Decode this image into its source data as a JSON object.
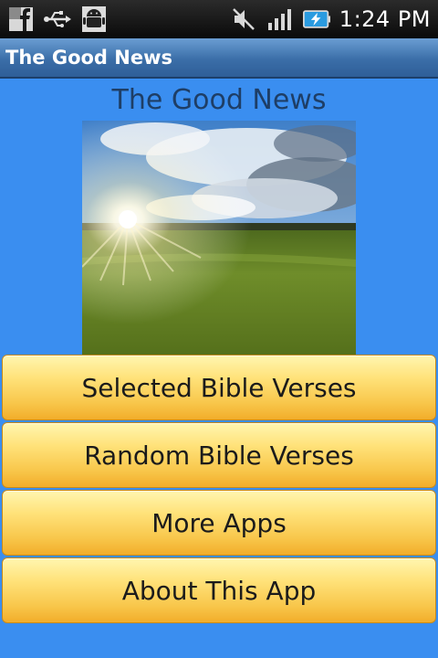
{
  "status_bar": {
    "time": "1:24 PM",
    "left_icons": [
      "facebook-notification-icon",
      "usb-icon",
      "android-debug-icon"
    ],
    "right_icons": [
      "mute-icon",
      "signal-icon",
      "battery-charging-icon"
    ]
  },
  "app": {
    "title": "The Good News"
  },
  "main": {
    "heading": "The Good News",
    "image_alt": "sunlit field with clouds",
    "buttons": [
      {
        "label": "Selected Bible Verses"
      },
      {
        "label": "Random Bible Verses"
      },
      {
        "label": "More Apps"
      },
      {
        "label": "About This App"
      }
    ]
  },
  "colors": {
    "background": "#3a8ef0",
    "titlebar": "#3b6ea8",
    "button_top": "#fff6b0",
    "button_bottom": "#f2ad2a"
  }
}
